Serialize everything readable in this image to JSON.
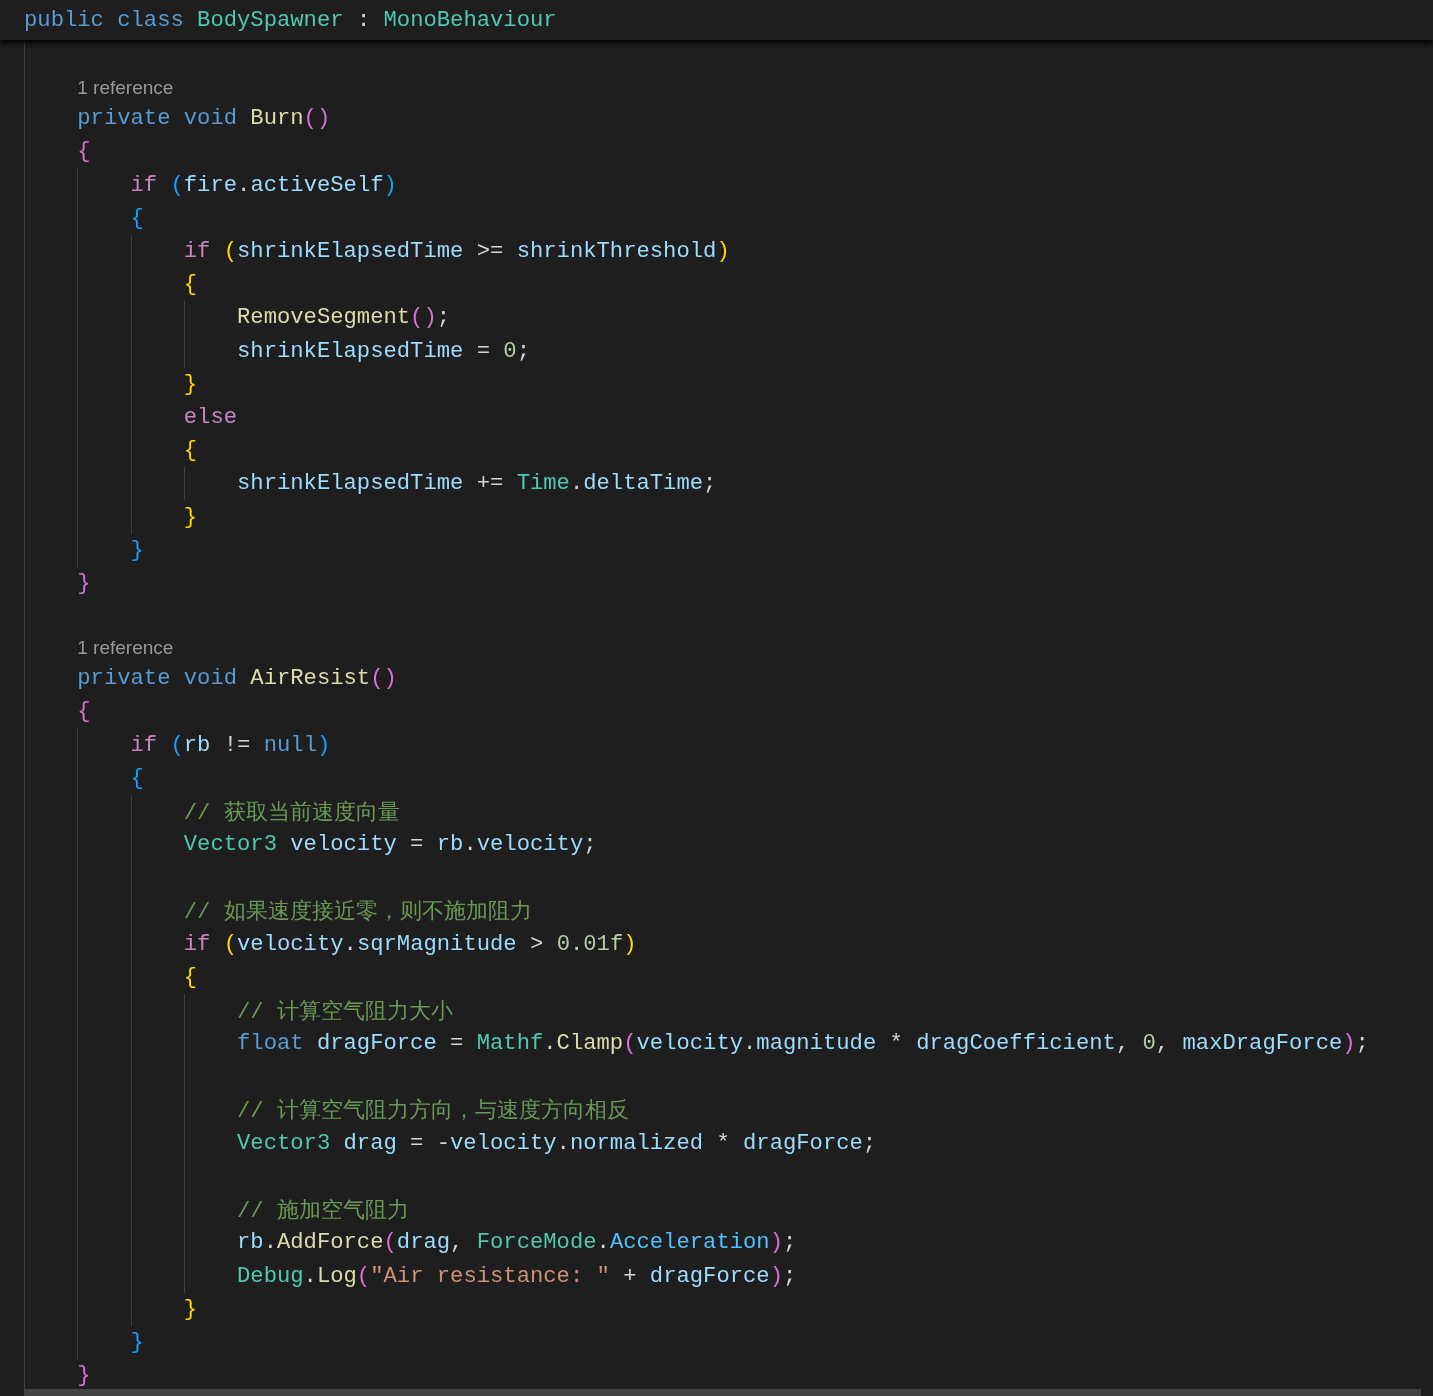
{
  "sticky_header": {
    "tokens": [
      {
        "kind": "kw",
        "text": "public"
      },
      {
        "kind": "kw",
        "text": " class"
      },
      {
        "kind": "type",
        "text": " BodySpawner"
      },
      {
        "kind": "op",
        "text": " :"
      },
      {
        "kind": "type",
        "text": " MonoBehaviour"
      }
    ]
  },
  "lines": [
    {
      "kind": "blank"
    },
    {
      "kind": "codelens",
      "text": "    1 reference"
    },
    {
      "kind": "code",
      "tokens": [
        {
          "kind": "kw",
          "text": "    private"
        },
        {
          "kind": "kw",
          "text": " void"
        },
        {
          "kind": "fn",
          "text": " Burn"
        },
        {
          "kind": "b2",
          "text": "()"
        }
      ]
    },
    {
      "kind": "code",
      "tokens": [
        {
          "kind": "b2",
          "text": "    {"
        }
      ]
    },
    {
      "kind": "code",
      "tokens": [
        {
          "kind": "ctrl",
          "text": "        if"
        },
        {
          "kind": "b3",
          "text": " ("
        },
        {
          "kind": "var",
          "text": "fire"
        },
        {
          "kind": "op",
          "text": "."
        },
        {
          "kind": "var",
          "text": "activeSelf"
        },
        {
          "kind": "b3",
          "text": ")"
        }
      ]
    },
    {
      "kind": "code",
      "tokens": [
        {
          "kind": "b3",
          "text": "        {"
        }
      ]
    },
    {
      "kind": "code",
      "tokens": [
        {
          "kind": "ctrl",
          "text": "            if"
        },
        {
          "kind": "b1",
          "text": " ("
        },
        {
          "kind": "var",
          "text": "shrinkElapsedTime"
        },
        {
          "kind": "op",
          "text": " >="
        },
        {
          "kind": "var",
          "text": " shrinkThreshold"
        },
        {
          "kind": "b1",
          "text": ")"
        }
      ]
    },
    {
      "kind": "code",
      "tokens": [
        {
          "kind": "b1",
          "text": "            {"
        }
      ]
    },
    {
      "kind": "code",
      "tokens": [
        {
          "kind": "fn",
          "text": "                RemoveSegment"
        },
        {
          "kind": "b2",
          "text": "()"
        },
        {
          "kind": "op",
          "text": ";"
        }
      ]
    },
    {
      "kind": "code",
      "tokens": [
        {
          "kind": "var",
          "text": "                shrinkElapsedTime"
        },
        {
          "kind": "op",
          "text": " ="
        },
        {
          "kind": "num",
          "text": " 0"
        },
        {
          "kind": "op",
          "text": ";"
        }
      ]
    },
    {
      "kind": "code",
      "tokens": [
        {
          "kind": "b1",
          "text": "            }"
        }
      ]
    },
    {
      "kind": "code",
      "tokens": [
        {
          "kind": "ctrl",
          "text": "            else"
        }
      ]
    },
    {
      "kind": "code",
      "tokens": [
        {
          "kind": "b1",
          "text": "            {"
        }
      ]
    },
    {
      "kind": "code",
      "tokens": [
        {
          "kind": "var",
          "text": "                shrinkElapsedTime"
        },
        {
          "kind": "op",
          "text": " +="
        },
        {
          "kind": "type",
          "text": " Time"
        },
        {
          "kind": "op",
          "text": "."
        },
        {
          "kind": "var",
          "text": "deltaTime"
        },
        {
          "kind": "op",
          "text": ";"
        }
      ]
    },
    {
      "kind": "code",
      "tokens": [
        {
          "kind": "b1",
          "text": "            }"
        }
      ]
    },
    {
      "kind": "code",
      "tokens": [
        {
          "kind": "b3",
          "text": "        }"
        }
      ]
    },
    {
      "kind": "code",
      "tokens": [
        {
          "kind": "b2",
          "text": "    }"
        }
      ]
    },
    {
      "kind": "blank"
    },
    {
      "kind": "codelens",
      "text": "    1 reference"
    },
    {
      "kind": "code",
      "tokens": [
        {
          "kind": "kw",
          "text": "    private"
        },
        {
          "kind": "kw",
          "text": " void"
        },
        {
          "kind": "fn",
          "text": " AirResist"
        },
        {
          "kind": "b2",
          "text": "()"
        }
      ]
    },
    {
      "kind": "code",
      "tokens": [
        {
          "kind": "b2",
          "text": "    {"
        }
      ]
    },
    {
      "kind": "code",
      "tokens": [
        {
          "kind": "ctrl",
          "text": "        if"
        },
        {
          "kind": "b3",
          "text": " ("
        },
        {
          "kind": "var",
          "text": "rb"
        },
        {
          "kind": "op",
          "text": " !="
        },
        {
          "kind": "kw",
          "text": " null"
        },
        {
          "kind": "b3",
          "text": ")"
        }
      ]
    },
    {
      "kind": "code",
      "tokens": [
        {
          "kind": "b3",
          "text": "        {"
        }
      ]
    },
    {
      "kind": "code",
      "tokens": [
        {
          "kind": "com",
          "text": "            // 获取当前速度向量"
        }
      ]
    },
    {
      "kind": "code",
      "tokens": [
        {
          "kind": "type",
          "text": "            Vector3"
        },
        {
          "kind": "var",
          "text": " velocity"
        },
        {
          "kind": "op",
          "text": " ="
        },
        {
          "kind": "var",
          "text": " rb"
        },
        {
          "kind": "op",
          "text": "."
        },
        {
          "kind": "var",
          "text": "velocity"
        },
        {
          "kind": "op",
          "text": ";"
        }
      ]
    },
    {
      "kind": "blank"
    },
    {
      "kind": "code",
      "tokens": [
        {
          "kind": "com",
          "text": "            // 如果速度接近零，则不施加阻力"
        }
      ]
    },
    {
      "kind": "code",
      "tokens": [
        {
          "kind": "ctrl",
          "text": "            if"
        },
        {
          "kind": "b1",
          "text": " ("
        },
        {
          "kind": "var",
          "text": "velocity"
        },
        {
          "kind": "op",
          "text": "."
        },
        {
          "kind": "var",
          "text": "sqrMagnitude"
        },
        {
          "kind": "op",
          "text": " >"
        },
        {
          "kind": "num",
          "text": " 0.01f"
        },
        {
          "kind": "b1",
          "text": ")"
        }
      ]
    },
    {
      "kind": "code",
      "tokens": [
        {
          "kind": "b1",
          "text": "            {"
        }
      ]
    },
    {
      "kind": "code",
      "tokens": [
        {
          "kind": "com",
          "text": "                // 计算空气阻力大小"
        }
      ]
    },
    {
      "kind": "code",
      "tokens": [
        {
          "kind": "kw",
          "text": "                float"
        },
        {
          "kind": "var",
          "text": " dragForce"
        },
        {
          "kind": "op",
          "text": " ="
        },
        {
          "kind": "type",
          "text": " Mathf"
        },
        {
          "kind": "op",
          "text": "."
        },
        {
          "kind": "fn",
          "text": "Clamp"
        },
        {
          "kind": "b2",
          "text": "("
        },
        {
          "kind": "var",
          "text": "velocity"
        },
        {
          "kind": "op",
          "text": "."
        },
        {
          "kind": "var",
          "text": "magnitude"
        },
        {
          "kind": "op",
          "text": " *"
        },
        {
          "kind": "var",
          "text": " dragCoefficient"
        },
        {
          "kind": "op",
          "text": ","
        },
        {
          "kind": "num",
          "text": " 0"
        },
        {
          "kind": "op",
          "text": ","
        },
        {
          "kind": "var",
          "text": " maxDragForce"
        },
        {
          "kind": "b2",
          "text": ")"
        },
        {
          "kind": "op",
          "text": ";"
        }
      ]
    },
    {
      "kind": "blank"
    },
    {
      "kind": "code",
      "tokens": [
        {
          "kind": "com",
          "text": "                // 计算空气阻力方向，与速度方向相反"
        }
      ]
    },
    {
      "kind": "code",
      "tokens": [
        {
          "kind": "type",
          "text": "                Vector3"
        },
        {
          "kind": "var",
          "text": " drag"
        },
        {
          "kind": "op",
          "text": " = -"
        },
        {
          "kind": "var",
          "text": "velocity"
        },
        {
          "kind": "op",
          "text": "."
        },
        {
          "kind": "var",
          "text": "normalized"
        },
        {
          "kind": "op",
          "text": " *"
        },
        {
          "kind": "var",
          "text": " dragForce"
        },
        {
          "kind": "op",
          "text": ";"
        }
      ]
    },
    {
      "kind": "blank"
    },
    {
      "kind": "code",
      "tokens": [
        {
          "kind": "com",
          "text": "                // 施加空气阻力"
        }
      ]
    },
    {
      "kind": "code",
      "tokens": [
        {
          "kind": "var",
          "text": "                rb"
        },
        {
          "kind": "op",
          "text": "."
        },
        {
          "kind": "fn",
          "text": "AddForce"
        },
        {
          "kind": "b2",
          "text": "("
        },
        {
          "kind": "var",
          "text": "drag"
        },
        {
          "kind": "op",
          "text": ","
        },
        {
          "kind": "type",
          "text": " ForceMode"
        },
        {
          "kind": "op",
          "text": "."
        },
        {
          "kind": "enum",
          "text": "Acceleration"
        },
        {
          "kind": "b2",
          "text": ")"
        },
        {
          "kind": "op",
          "text": ";"
        }
      ]
    },
    {
      "kind": "code",
      "tokens": [
        {
          "kind": "type",
          "text": "                Debug"
        },
        {
          "kind": "op",
          "text": "."
        },
        {
          "kind": "fn",
          "text": "Log"
        },
        {
          "kind": "b2",
          "text": "("
        },
        {
          "kind": "str",
          "text": "\"Air resistance: \""
        },
        {
          "kind": "op",
          "text": " +"
        },
        {
          "kind": "var",
          "text": " dragForce"
        },
        {
          "kind": "b2",
          "text": ")"
        },
        {
          "kind": "op",
          "text": ";"
        }
      ]
    },
    {
      "kind": "code",
      "tokens": [
        {
          "kind": "b1",
          "text": "            }"
        }
      ]
    },
    {
      "kind": "code",
      "tokens": [
        {
          "kind": "b3",
          "text": "        }"
        }
      ]
    },
    {
      "kind": "code",
      "tokens": [
        {
          "kind": "b2",
          "text": "    }"
        }
      ]
    }
  ]
}
